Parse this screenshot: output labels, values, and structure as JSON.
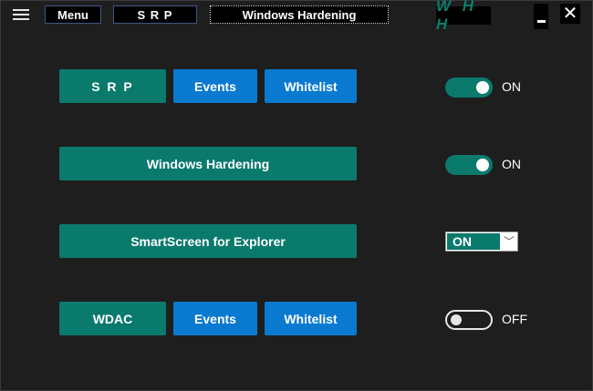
{
  "topbar": {
    "menu_label": "Menu",
    "srp_label": "S R P",
    "title": "Windows Hardening",
    "logo_text": "W H H"
  },
  "rows": {
    "srp": {
      "label": "S R P",
      "events_label": "Events",
      "whitelist_label": "Whitelist",
      "state": "ON"
    },
    "hardening": {
      "label": "Windows Hardening",
      "state": "ON"
    },
    "smartscreen": {
      "label": "SmartScreen for Explorer",
      "selected": "ON"
    },
    "wdac": {
      "label": "WDAC",
      "events_label": "Events",
      "whitelist_label": "Whitelist",
      "state": "OFF"
    }
  },
  "colors": {
    "teal": "#0a7a6d",
    "blue": "#0a7ad0",
    "background": "#1e1e1e"
  }
}
